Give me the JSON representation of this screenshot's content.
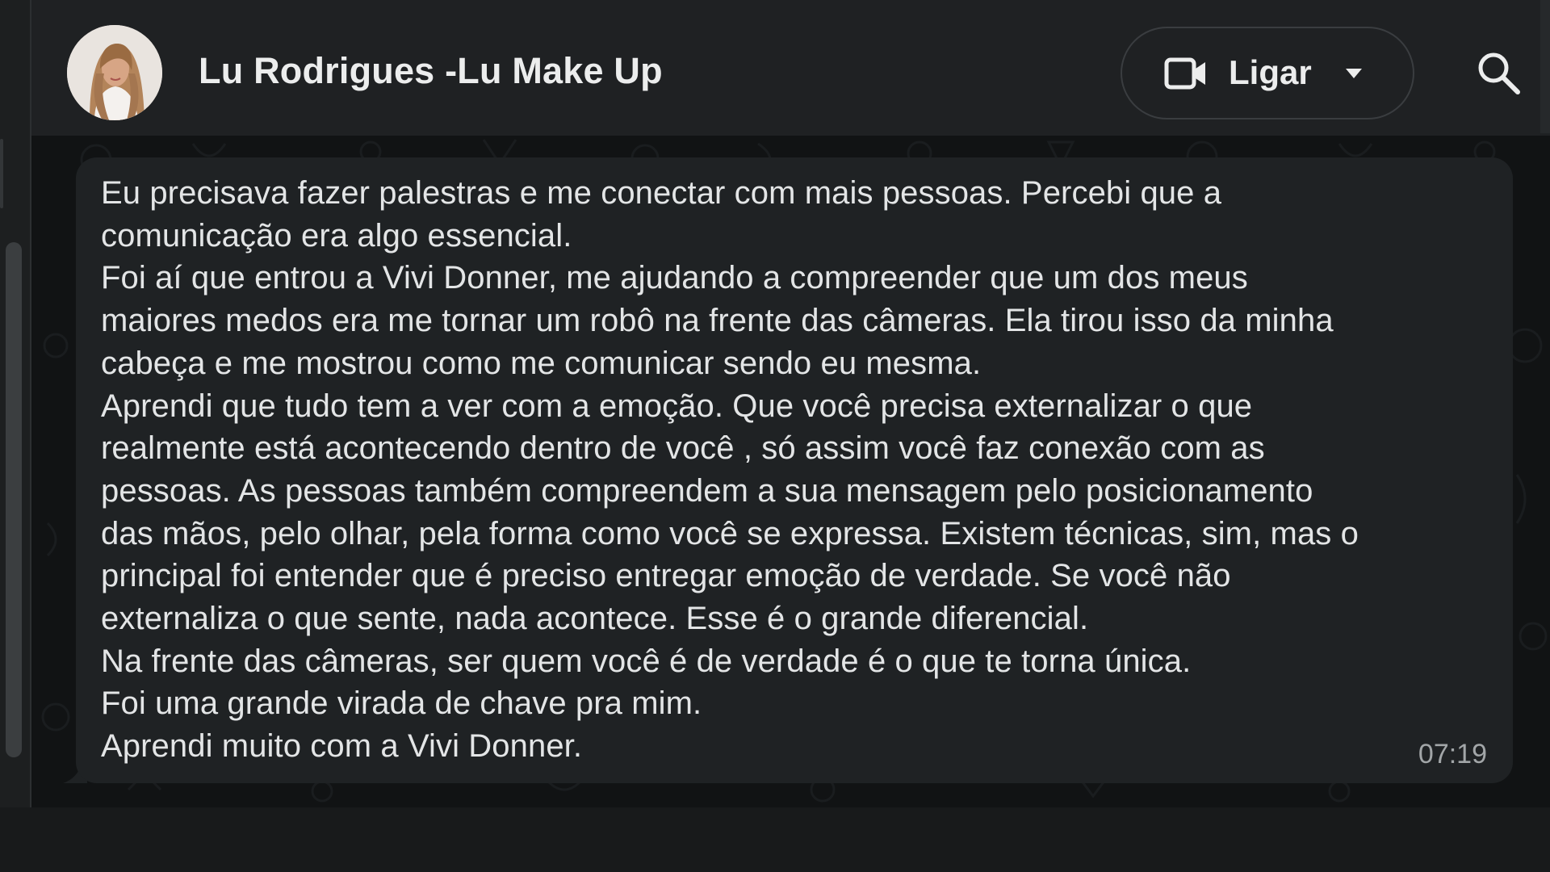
{
  "contact": {
    "name": "Lu Rodrigues -Lu Make Up"
  },
  "header": {
    "call_label": "Ligar",
    "icons": {
      "video": "video-camera-icon",
      "dropdown": "chevron-down-icon",
      "search": "search-icon"
    }
  },
  "message": {
    "lines": [
      "Eu precisava fazer palestras e me conectar com mais pessoas. Percebi que a",
      "comunicação era algo essencial.",
      "Foi aí que entrou a Vivi Donner, me ajudando a compreender que um dos meus",
      "maiores medos era me tornar um robô na frente das câmeras. Ela tirou isso da minha",
      "cabeça e me mostrou como me comunicar sendo eu mesma.",
      "Aprendi que tudo tem a ver com a emoção. Que você precisa externalizar o que",
      "realmente está acontecendo dentro de você , só assim você faz conexão com as",
      "pessoas. As pessoas também compreendem a sua mensagem pelo posicionamento",
      "das mãos, pelo olhar, pela forma como você se expressa. Existem técnicas, sim, mas o",
      "principal foi entender que é preciso entregar emoção de verdade. Se você não",
      "externaliza o que sente, nada acontece. Esse é o grande diferencial.",
      "Na frente das câmeras, ser quem você é de verdade é o que te torna única.",
      "Foi uma grande virada de chave pra mim.",
      "Aprendi muito com a Vivi Donner."
    ],
    "time": "07:19"
  },
  "colors": {
    "background": "#111314",
    "header": "#1f2123",
    "bubble": "#1f2224",
    "text": "#e3e5e6",
    "timestamp": "#a2a6a8"
  }
}
